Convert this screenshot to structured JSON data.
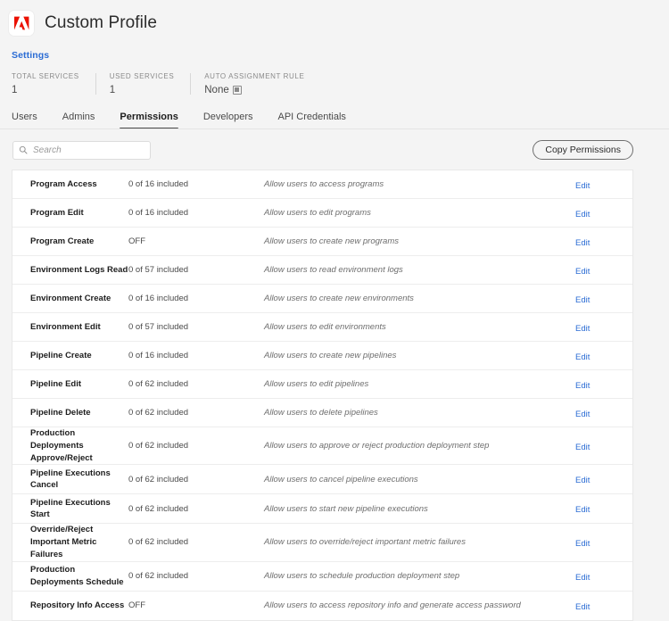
{
  "header": {
    "logo_icon": "adobe-logo-icon",
    "title": "Custom Profile",
    "breadcrumb_label": "Settings",
    "meta": [
      {
        "label": "TOTAL SERVICES",
        "value": "1",
        "has_edit_icon": false
      },
      {
        "label": "USED SERVICES",
        "value": "1",
        "has_edit_icon": false
      },
      {
        "label": "AUTO ASSIGNMENT RULE",
        "value": "None",
        "has_edit_icon": true
      }
    ]
  },
  "tabs": [
    {
      "label": "Users",
      "active": false
    },
    {
      "label": "Admins",
      "active": false
    },
    {
      "label": "Permissions",
      "active": true
    },
    {
      "label": "Developers",
      "active": false
    },
    {
      "label": "API Credentials",
      "active": false
    }
  ],
  "toolbar": {
    "search_placeholder": "Search",
    "search_value": "",
    "search_icon": "search-icon",
    "copy_permissions_label": "Copy Permissions"
  },
  "colors": {
    "accent_link": "#2b6cd4",
    "brand_red": "#eb1000",
    "page_background": "#f4f4f4",
    "table_background": "#ffffff"
  },
  "permissions": [
    {
      "name": "Program Access",
      "status": "0 of 16 included",
      "description": "Allow users to access programs",
      "action": "Edit"
    },
    {
      "name": "Program Edit",
      "status": "0 of 16 included",
      "description": "Allow users to edit programs",
      "action": "Edit"
    },
    {
      "name": "Program Create",
      "status": "OFF",
      "description": "Allow users to create new programs",
      "action": "Edit"
    },
    {
      "name": "Environment Logs Read",
      "status": "0 of 57 included",
      "description": "Allow users to read environment logs",
      "action": "Edit"
    },
    {
      "name": "Environment Create",
      "status": "0 of 16 included",
      "description": "Allow users to create new environments",
      "action": "Edit"
    },
    {
      "name": "Environment Edit",
      "status": "0 of 57 included",
      "description": "Allow users to edit environments",
      "action": "Edit"
    },
    {
      "name": "Pipeline Create",
      "status": "0 of 16 included",
      "description": "Allow users to create new pipelines",
      "action": "Edit"
    },
    {
      "name": "Pipeline Edit",
      "status": "0 of 62 included",
      "description": "Allow users to edit pipelines",
      "action": "Edit"
    },
    {
      "name": "Pipeline Delete",
      "status": "0 of 62 included",
      "description": "Allow users to delete pipelines",
      "action": "Edit"
    },
    {
      "name": "Production Deployments Approve/Reject",
      "status": "0 of 62 included",
      "description": "Allow users to approve or reject production deployment step",
      "action": "Edit"
    },
    {
      "name": "Pipeline Executions Cancel",
      "status": "0 of 62 included",
      "description": "Allow users to cancel pipeline executions",
      "action": "Edit"
    },
    {
      "name": "Pipeline Executions Start",
      "status": "0 of 62 included",
      "description": "Allow users to start new pipeline executions",
      "action": "Edit"
    },
    {
      "name": "Override/Reject Important Metric Failures",
      "status": "0 of 62 included",
      "description": "Allow users to override/reject important metric failures",
      "action": "Edit"
    },
    {
      "name": "Production Deployments Schedule",
      "status": "0 of 62 included",
      "description": "Allow users to schedule production deployment step",
      "action": "Edit"
    },
    {
      "name": "Repository Info Access",
      "status": "OFF",
      "description": "Allow users to access repository info and generate access password",
      "action": "Edit"
    }
  ]
}
